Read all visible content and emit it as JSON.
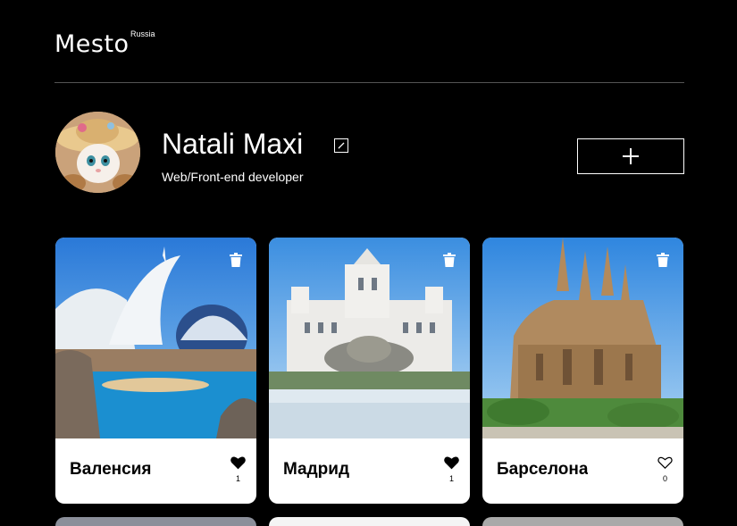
{
  "header": {
    "logo": "Mesto",
    "logo_sup": "Russia"
  },
  "profile": {
    "name": "Natali Maxi",
    "job": "Web/Front-end developer"
  },
  "cards": [
    {
      "title": "Валенсия",
      "likes": "1",
      "liked": true
    },
    {
      "title": "Мадрид",
      "likes": "1",
      "liked": true
    },
    {
      "title": "Барселона",
      "likes": "0",
      "liked": false
    }
  ],
  "colors": {
    "background": "#000000",
    "card": "#ffffff",
    "divider": "#545454"
  },
  "icons": [
    "edit-icon",
    "plus-icon",
    "trash-icon",
    "heart-icon"
  ]
}
